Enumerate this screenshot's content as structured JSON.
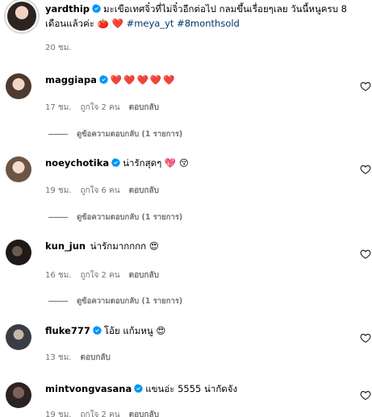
{
  "caption": {
    "username": "yardthip",
    "text": "มะเขือเทศจิ๋วที่ไม่จิ๋วอีกต่อไป กลมขึ้นเรื่อยๆเลย วันนี้หนูครบ 8 เดือนแล้วค่ะ 🍅 ❤️",
    "hashtags": [
      "#meya_yt",
      "#8monthsold"
    ],
    "time": "20 ชม."
  },
  "comments": [
    {
      "username": "maggiapa",
      "verified": true,
      "text": "❤️❤️❤️❤️❤️",
      "time": "17 ชม.",
      "likes": "ถูกใจ 2 คน",
      "reply_label": "ตอบกลับ",
      "view_replies": "ดูข้อความตอบกลับ (1 รายการ)"
    },
    {
      "username": "noeychotika",
      "verified": true,
      "text": "น่ารักสุดๆ 💖 😚",
      "time": "19 ชม.",
      "likes": "ถูกใจ 6 คน",
      "reply_label": "ตอบกลับ",
      "view_replies": "ดูข้อความตอบกลับ (1 รายการ)"
    },
    {
      "username": "kun_jun",
      "verified": false,
      "text": "น่ารักมากกกก 😍",
      "time": "16 ชม.",
      "likes": "ถูกใจ 2 คน",
      "reply_label": "ตอบกลับ",
      "view_replies": "ดูข้อความตอบกลับ (1 รายการ)"
    },
    {
      "username": "fluke777",
      "verified": true,
      "text": "โอ้ย แก้มหนู 😍",
      "time": "13 ชม.",
      "likes": "",
      "reply_label": "ตอบกลับ",
      "view_replies": ""
    },
    {
      "username": "mintvongvasana",
      "verified": true,
      "text": "แขนอ่ะ 5555 น่ากัดจัง",
      "time": "19 ชม.",
      "likes": "ถูกใจ 2 คน",
      "reply_label": "ตอบกลับ",
      "view_replies": ""
    }
  ],
  "icons": {
    "verified": "verified-badge-icon",
    "like": "heart-outline-icon"
  },
  "colors": {
    "verified_blue": "#0095f6",
    "hashtag": "#00376b",
    "secondary_text": "#737373",
    "heart_red": "#e0263a"
  }
}
